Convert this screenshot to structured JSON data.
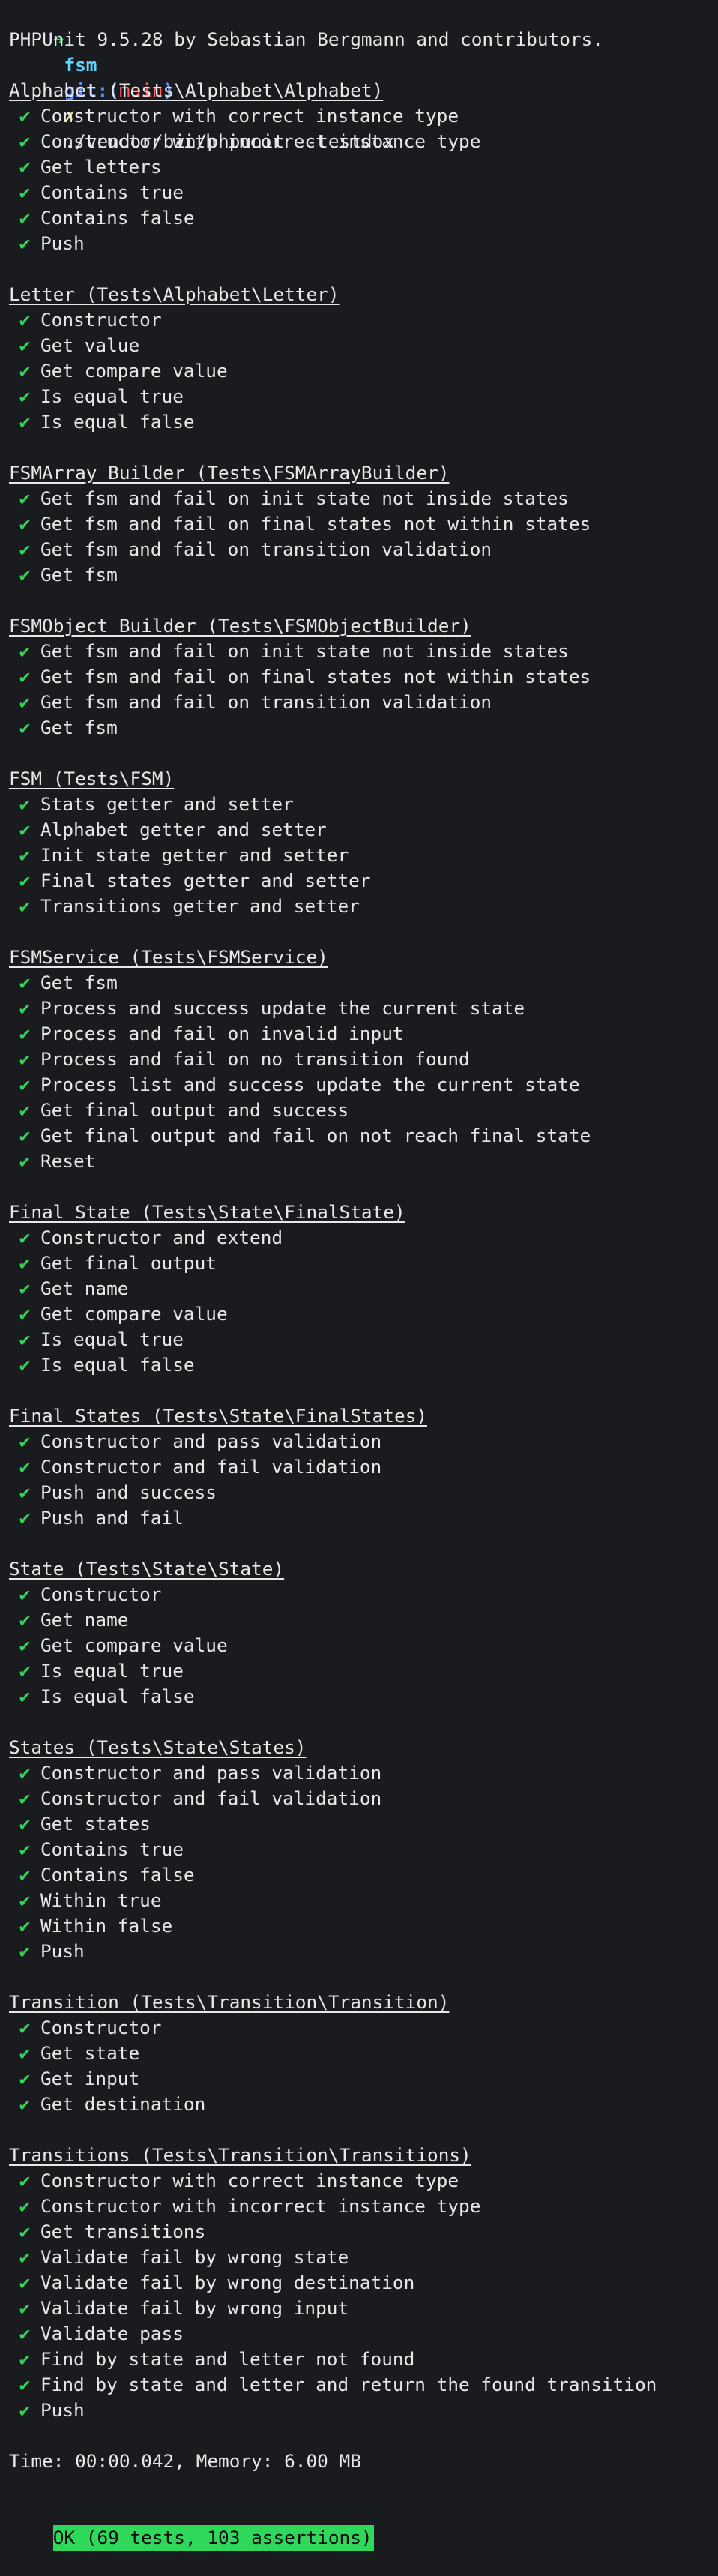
{
  "prompt": {
    "arrow": "➜",
    "dir": "fsm",
    "git_label": "git:",
    "branch_open": "(",
    "branch": "main",
    "branch_close": ")",
    "dirty_mark": "✗",
    "command": "./vendor/bin/phpunit --testdox"
  },
  "header": "PHPUnit 9.5.28 by Sebastian Bergmann and contributors.",
  "check_icon": "check-mark",
  "check_glyph": "✔",
  "suites": [
    {
      "title": "Alphabet (Tests\\Alphabet\\Alphabet)",
      "tests": [
        "Constructor with correct instance type",
        "Constructor with incorrect instance type",
        "Get letters",
        "Contains true",
        "Contains false",
        "Push"
      ]
    },
    {
      "title": "Letter (Tests\\Alphabet\\Letter)",
      "tests": [
        "Constructor",
        "Get value",
        "Get compare value",
        "Is equal true",
        "Is equal false"
      ]
    },
    {
      "title": "FSMArray Builder (Tests\\FSMArrayBuilder)",
      "tests": [
        "Get fsm and fail on init state not inside states",
        "Get fsm and fail on final states not within states",
        "Get fsm and fail on transition validation",
        "Get fsm"
      ]
    },
    {
      "title": "FSMObject Builder (Tests\\FSMObjectBuilder)",
      "tests": [
        "Get fsm and fail on init state not inside states",
        "Get fsm and fail on final states not within states",
        "Get fsm and fail on transition validation",
        "Get fsm"
      ]
    },
    {
      "title": "FSM (Tests\\FSM)",
      "tests": [
        "Stats getter and setter",
        "Alphabet getter and setter",
        "Init state getter and setter",
        "Final states getter and setter",
        "Transitions getter and setter"
      ]
    },
    {
      "title": "FSMService (Tests\\FSMService)",
      "tests": [
        "Get fsm",
        "Process and success update the current state",
        "Process and fail on invalid input",
        "Process and fail on no transition found",
        "Process list and success update the current state",
        "Get final output and success",
        "Get final output and fail on not reach final state",
        "Reset"
      ]
    },
    {
      "title": "Final State (Tests\\State\\FinalState)",
      "tests": [
        "Constructor and extend",
        "Get final output",
        "Get name",
        "Get compare value",
        "Is equal true",
        "Is equal false"
      ]
    },
    {
      "title": "Final States (Tests\\State\\FinalStates)",
      "tests": [
        "Constructor and pass validation",
        "Constructor and fail validation",
        "Push and success",
        "Push and fail"
      ]
    },
    {
      "title": "State (Tests\\State\\State)",
      "tests": [
        "Constructor",
        "Get name",
        "Get compare value",
        "Is equal true",
        "Is equal false"
      ]
    },
    {
      "title": "States (Tests\\State\\States)",
      "tests": [
        "Constructor and pass validation",
        "Constructor and fail validation",
        "Get states",
        "Contains true",
        "Contains false",
        "Within true",
        "Within false",
        "Push"
      ]
    },
    {
      "title": "Transition (Tests\\Transition\\Transition)",
      "tests": [
        "Constructor",
        "Get state",
        "Get input",
        "Get destination"
      ]
    },
    {
      "title": "Transitions (Tests\\Transition\\Transitions)",
      "tests": [
        "Constructor with correct instance type",
        "Constructor with incorrect instance type",
        "Get transitions",
        "Validate fail by wrong state",
        "Validate fail by wrong destination",
        "Validate fail by wrong input",
        "Validate pass",
        "Find by state and letter not found",
        "Find by state and letter and return the found transition",
        "Push"
      ]
    }
  ],
  "summary": {
    "time": "Time: 00:00.042, Memory: 6.00 MB",
    "result": "OK (69 tests, 103 assertions)"
  },
  "colors": {
    "background": "#1a1b1e",
    "foreground": "#e8e8e8",
    "success": "#2fd75b"
  }
}
